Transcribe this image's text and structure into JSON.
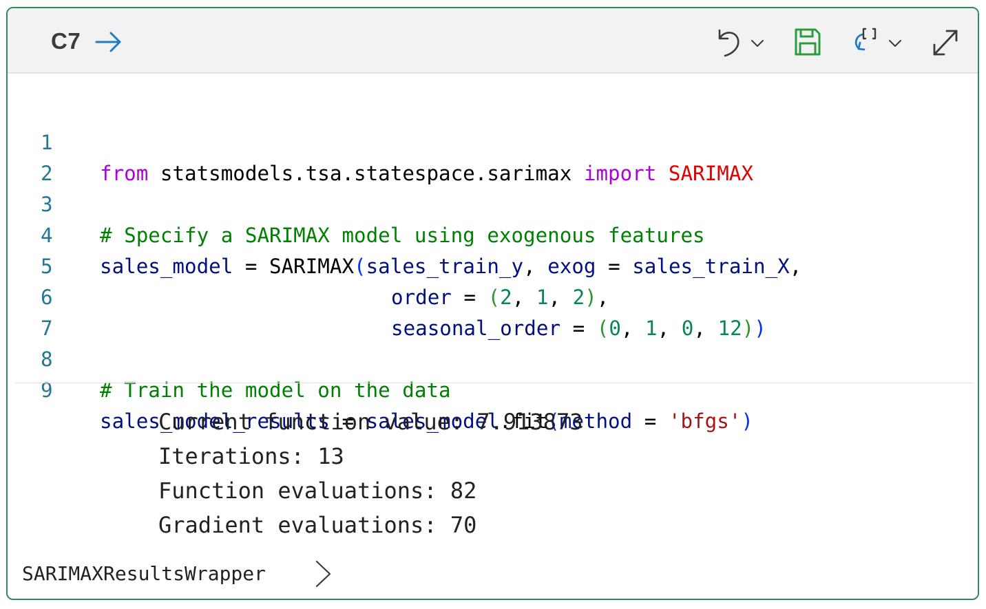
{
  "cell": {
    "id": "C7",
    "border_color": "#2e8b57"
  },
  "toolbar": {
    "run_icon": "arrow-right-icon",
    "undo_icon": "undo-icon",
    "save_icon": "save-icon",
    "refresh_icon": "refresh-icon",
    "expand_icon": "expand-icon"
  },
  "code_lines": [
    {
      "num": "1"
    },
    {
      "num": "2"
    },
    {
      "num": "3"
    },
    {
      "num": "4"
    },
    {
      "num": "5"
    },
    {
      "num": "6"
    },
    {
      "num": "7"
    },
    {
      "num": "8"
    },
    {
      "num": "9"
    }
  ],
  "code": {
    "l1": {
      "kw1": "from",
      "module": " statsmodels.tsa.statespace.sarimax ",
      "kw2": "import",
      "cls": " SARIMAX"
    },
    "l3": {
      "comment": "# Specify a SARIMAX model using exogenous features"
    },
    "l4": {
      "var": "sales_model",
      "eq": " = SARIMAX",
      "open": "(",
      "arg1": "sales_train_y",
      "comma1": ", ",
      "kw": "exog",
      "eq2": " = ",
      "arg2": "sales_train_X",
      "comma2": ","
    },
    "l5": {
      "kw": "order",
      "eq": " = ",
      "open": "(",
      "n1": "2",
      "c1": ", ",
      "n2": "1",
      "c2": ", ",
      "n3": "2",
      "close": ")",
      "comma": ","
    },
    "l6": {
      "kw": "seasonal_order",
      "eq": " = ",
      "open": "(",
      "n1": "0",
      "c1": ", ",
      "n2": "1",
      "c2": ", ",
      "n3": "0",
      "c3": ", ",
      "n4": "12",
      "close1": ")",
      "close2": ")"
    },
    "l8": {
      "comment": "# Train the model on the data"
    },
    "l9": {
      "var": "sales_model_results",
      "eq": " = ",
      "obj": "sales_model",
      "meth": ".fit",
      "open": "(",
      "kw": "method",
      "eq2": " = ",
      "str": "'bfgs'",
      "close": ")"
    }
  },
  "output": {
    "lines": [
      "Current function value: 7.913873",
      "Iterations: 13",
      "Function evaluations: 82",
      "Gradient evaluations: 70"
    ],
    "result_label": "SARIMAXResultsWrapper",
    "result_icon": "chevron-right-icon"
  }
}
